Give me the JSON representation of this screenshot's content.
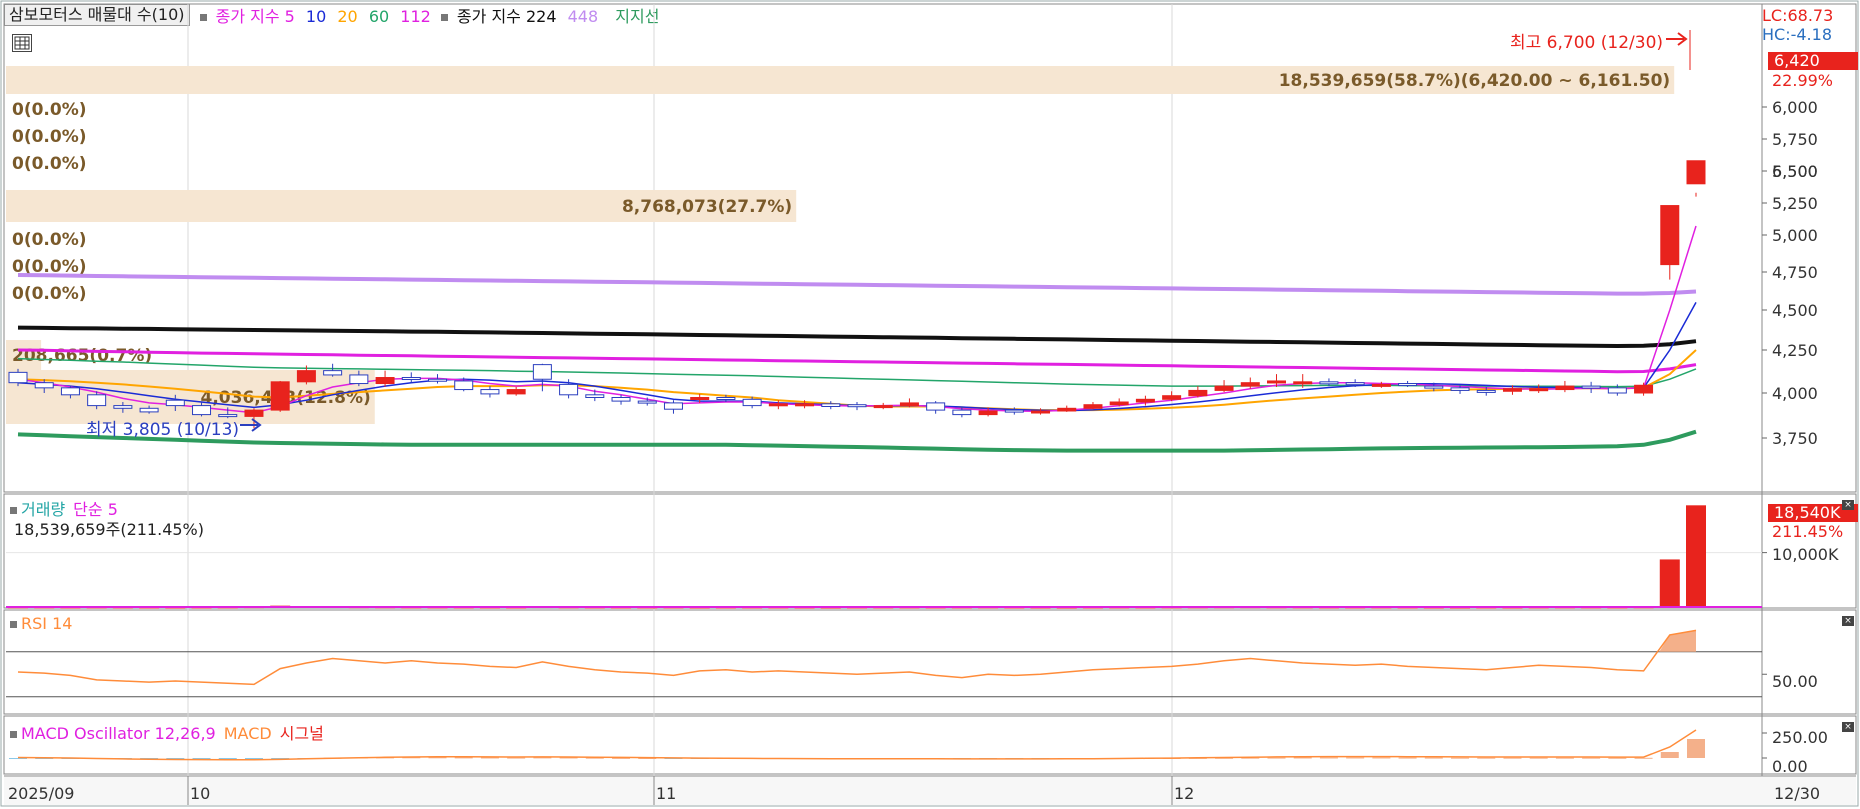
{
  "colors": {
    "up": "#e8231d",
    "down": "#2b3fbf",
    "ma5": "#e020e0",
    "ma10": "#1a2bd6",
    "ma20": "#ffa500",
    "ma60": "#23a56a",
    "ma112": "#e020e0",
    "ma224": "#111111",
    "ma448": "#c08cf0",
    "support": "#2e9b5e",
    "rsi": "#ff8c3a",
    "macd_osc": "#e020e0",
    "signal": "#e8231d",
    "volbar": "#e8231d",
    "profile": "#f6e6d2"
  },
  "header": {
    "title": "삼보모터스 매물대 수(10)",
    "ma_label": "종가 지수 5",
    "ma_periods": [
      "10",
      "20",
      "60",
      "112"
    ],
    "ma2_label": "종가 지수 224",
    "ma2_periods": [
      "448"
    ],
    "support_label": "지지선"
  },
  "price_panel": {
    "lc": "LC:68.73",
    "hc": "HC:-4.18",
    "current": "6,420",
    "change_pct": "22.99%",
    "yticks": [
      "6,500",
      "6,000",
      "5,750",
      "5,500",
      "5,250",
      "5,000",
      "4,750",
      "4,500",
      "4,250",
      "4,000",
      "3,750"
    ],
    "high_note": "최고 6,700 (12/30)",
    "low_note": "최저 3,805 (10/13)",
    "profile": [
      {
        "label": "18,539,659(58.7%)(6,420.00 ~ 6,161.50)",
        "w": 0.95,
        "hot": true
      },
      {
        "label": "0(0.0%)",
        "w": 0
      },
      {
        "label": "0(0.0%)",
        "w": 0
      },
      {
        "label": "0(0.0%)",
        "w": 0
      },
      {
        "label": "8,768,073(27.7%)",
        "w": 0.45
      },
      {
        "label": "0(0.0%)",
        "w": 0
      },
      {
        "label": "0(0.0%)",
        "w": 0
      },
      {
        "label": "0(0.0%)",
        "w": 0
      },
      {
        "label": "208,665(0.7%)",
        "w": 0.02
      },
      {
        "label": "4,036,443(12.8%)",
        "w": 0.21
      }
    ]
  },
  "volume_panel": {
    "title": "거래량",
    "ma_label": "단순 5",
    "summary": "18,539,659주(211.45%)",
    "current": "18,540K",
    "pct": "211.45%",
    "tick": "10,000K"
  },
  "rsi_panel": {
    "title": "RSI 14",
    "tick": "50.00"
  },
  "macd_panel": {
    "title": "MACD Oscillator 12,26,9",
    "l2": "MACD",
    "l3": "시그널",
    "ticks": [
      "250.00",
      "0.00"
    ]
  },
  "xaxis": {
    "labels": [
      "2025/09",
      "10",
      "11",
      "12"
    ],
    "last": "12/30"
  },
  "chart_data": {
    "type": "candlestick",
    "x_dates": [
      "2025/09/29",
      "2025/09/30",
      "2025/10/01",
      "2025/10/02",
      "2025/10/06",
      "2025/10/07",
      "2025/10/08",
      "2025/10/09",
      "2025/10/10",
      "2025/10/13",
      "2025/10/14",
      "2025/10/15",
      "2025/10/16",
      "2025/10/17",
      "2025/10/20",
      "2025/10/21",
      "2025/10/22",
      "2025/10/23",
      "2025/10/24",
      "2025/10/27",
      "2025/10/28",
      "2025/10/29",
      "2025/10/30",
      "2025/10/31",
      "2025/11/03",
      "2025/11/04",
      "2025/11/05",
      "2025/11/06",
      "2025/11/07",
      "2025/11/10",
      "2025/11/11",
      "2025/11/12",
      "2025/11/13",
      "2025/11/14",
      "2025/11/17",
      "2025/11/18",
      "2025/11/19",
      "2025/11/20",
      "2025/11/21",
      "2025/11/24",
      "2025/11/25",
      "2025/11/26",
      "2025/11/27",
      "2025/11/28",
      "2025/12/01",
      "2025/12/02",
      "2025/12/03",
      "2025/12/04",
      "2025/12/05",
      "2025/12/08",
      "2025/12/09",
      "2025/12/10",
      "2025/12/11",
      "2025/12/12",
      "2025/12/15",
      "2025/12/16",
      "2025/12/17",
      "2025/12/18",
      "2025/12/19",
      "2025/12/22",
      "2025/12/23",
      "2025/12/24",
      "2025/12/26",
      "2025/12/29",
      "2025/12/30"
    ],
    "open": [
      4120,
      4060,
      4030,
      3990,
      3930,
      3915,
      3960,
      3930,
      3880,
      3870,
      3905,
      4065,
      4130,
      4105,
      4055,
      4090,
      4080,
      4070,
      4020,
      3995,
      4165,
      4050,
      3990,
      3975,
      3955,
      3945,
      3965,
      3975,
      3965,
      3930,
      3940,
      3940,
      3935,
      3925,
      3930,
      3945,
      3905,
      3880,
      3905,
      3895,
      3900,
      3915,
      3935,
      3950,
      3965,
      3985,
      4015,
      4040,
      4060,
      4060,
      4065,
      4060,
      4050,
      4055,
      4040,
      4030,
      4015,
      4010,
      4025,
      4020,
      4040,
      4030,
      4000,
      4800,
      5400
    ],
    "close": [
      4060,
      4030,
      3990,
      3930,
      3915,
      3895,
      3930,
      3880,
      3870,
      3905,
      4065,
      4130,
      4105,
      4055,
      4090,
      4080,
      4070,
      4020,
      3995,
      4020,
      4080,
      3990,
      3975,
      3955,
      3945,
      3910,
      3975,
      3965,
      3930,
      3940,
      3940,
      3925,
      3925,
      3930,
      3945,
      3905,
      3880,
      3900,
      3895,
      3900,
      3915,
      3935,
      3950,
      3965,
      3985,
      4015,
      4040,
      4060,
      4070,
      4065,
      4060,
      4050,
      4050,
      4050,
      4030,
      4015,
      4010,
      4025,
      4025,
      4040,
      4030,
      4000,
      4045,
      5230,
      6420
    ],
    "high": [
      4140,
      4080,
      4040,
      4010,
      3950,
      3930,
      3990,
      3950,
      3920,
      3915,
      4070,
      4160,
      4170,
      4130,
      4130,
      4120,
      4110,
      4090,
      4040,
      4035,
      4170,
      4080,
      4020,
      3990,
      3975,
      3960,
      3995,
      3990,
      3980,
      3960,
      3960,
      3955,
      3950,
      3945,
      3970,
      3955,
      3925,
      3920,
      3920,
      3915,
      3930,
      3950,
      3970,
      3985,
      4010,
      4040,
      4075,
      4090,
      4110,
      4110,
      4085,
      4080,
      4065,
      4070,
      4060,
      4045,
      4035,
      4045,
      4050,
      4070,
      4065,
      4050,
      4060,
      5230,
      6700
    ],
    "low": [
      4040,
      4000,
      3970,
      3910,
      3890,
      3885,
      3900,
      3870,
      3860,
      3805,
      3895,
      4050,
      4095,
      4040,
      4035,
      4060,
      4055,
      4010,
      3975,
      3985,
      4010,
      3970,
      3955,
      3935,
      3930,
      3885,
      3945,
      3950,
      3915,
      3910,
      3915,
      3910,
      3905,
      3910,
      3920,
      3885,
      3865,
      3870,
      3880,
      3880,
      3895,
      3910,
      3925,
      3930,
      3955,
      3975,
      4005,
      4025,
      4035,
      4030,
      4040,
      4035,
      4030,
      4035,
      4010,
      3995,
      3985,
      3990,
      4000,
      4005,
      4000,
      3985,
      3985,
      4700,
      5330
    ],
    "volume_k": [
      120,
      110,
      95,
      105,
      100,
      90,
      85,
      95,
      110,
      150,
      420,
      260,
      180,
      150,
      130,
      110,
      105,
      100,
      95,
      90,
      170,
      120,
      100,
      90,
      95,
      100,
      85,
      90,
      95,
      90,
      85,
      80,
      90,
      95,
      100,
      90,
      100,
      110,
      90,
      85,
      80,
      90,
      100,
      95,
      110,
      120,
      130,
      140,
      120,
      110,
      100,
      95,
      100,
      90,
      85,
      80,
      90,
      85,
      100,
      110,
      105,
      95,
      120,
      8768,
      18540
    ],
    "ma224": [
      4390,
      4388,
      4386,
      4385,
      4383,
      4382,
      4380,
      4378,
      4377,
      4375,
      4373,
      4372,
      4370,
      4369,
      4367,
      4365,
      4364,
      4362,
      4360,
      4358,
      4356,
      4354,
      4352,
      4350,
      4348,
      4346,
      4344,
      4342,
      4340,
      4338,
      4336,
      4334,
      4332,
      4330,
      4328,
      4326,
      4324,
      4322,
      4320,
      4318,
      4316,
      4314,
      4312,
      4310,
      4308,
      4306,
      4304,
      4302,
      4300,
      4298,
      4296,
      4294,
      4292,
      4290,
      4288,
      4286,
      4284,
      4282,
      4280,
      4278,
      4276,
      4275,
      4276,
      4286,
      4305
    ],
    "ma448": [
      4730,
      4728,
      4726,
      4724,
      4722,
      4720,
      4718,
      4716,
      4714,
      4712,
      4710,
      4708,
      4706,
      4704,
      4702,
      4700,
      4698,
      4696,
      4694,
      4692,
      4690,
      4688,
      4686,
      4684,
      4682,
      4680,
      4678,
      4676,
      4674,
      4672,
      4670,
      4668,
      4666,
      4664,
      4662,
      4660,
      4658,
      4656,
      4654,
      4652,
      4650,
      4648,
      4646,
      4644,
      4642,
      4640,
      4638,
      4636,
      4634,
      4632,
      4630,
      4628,
      4626,
      4624,
      4622,
      4620,
      4618,
      4616,
      4614,
      4612,
      4610,
      4608,
      4608,
      4612,
      4622
    ],
    "ma112": [
      4250,
      4248,
      4245,
      4242,
      4240,
      4237,
      4235,
      4232,
      4230,
      4228,
      4226,
      4224,
      4222,
      4220,
      4218,
      4216,
      4214,
      4212,
      4210,
      4208,
      4206,
      4204,
      4202,
      4200,
      4198,
      4196,
      4194,
      4192,
      4190,
      4188,
      4186,
      4184,
      4182,
      4180,
      4178,
      4176,
      4174,
      4172,
      4170,
      4168,
      4166,
      4164,
      4162,
      4160,
      4158,
      4156,
      4154,
      4152,
      4150,
      4148,
      4146,
      4144,
      4142,
      4140,
      4138,
      4136,
      4134,
      4132,
      4130,
      4128,
      4126,
      4124,
      4125,
      4140,
      4165
    ],
    "ma60": [
      4200,
      4195,
      4190,
      4185,
      4180,
      4174,
      4168,
      4162,
      4156,
      4150,
      4146,
      4144,
      4142,
      4140,
      4138,
      4136,
      4134,
      4132,
      4130,
      4127,
      4125,
      4122,
      4119,
      4116,
      4113,
      4109,
      4106,
      4103,
      4100,
      4096,
      4092,
      4088,
      4084,
      4080,
      4076,
      4072,
      4068,
      4064,
      4060,
      4056,
      4052,
      4049,
      4046,
      4043,
      4040,
      4040,
      4040,
      4041,
      4042,
      4043,
      4044,
      4044,
      4044,
      4043,
      4042,
      4041,
      4040,
      4040,
      4039,
      4039,
      4038,
      4037,
      4039,
      4080,
      4140
    ],
    "ma20": [
      4080,
      4075,
      4068,
      4060,
      4050,
      4038,
      4025,
      4010,
      3995,
      3980,
      3975,
      3985,
      3995,
      4005,
      4015,
      4025,
      4035,
      4040,
      4040,
      4040,
      4045,
      4045,
      4040,
      4030,
      4020,
      4005,
      3995,
      3985,
      3975,
      3960,
      3950,
      3940,
      3930,
      3925,
      3925,
      3925,
      3920,
      3915,
      3910,
      3905,
      3905,
      3905,
      3908,
      3912,
      3918,
      3925,
      3935,
      3948,
      3960,
      3970,
      3980,
      3990,
      4000,
      4008,
      4015,
      4020,
      4022,
      4024,
      4026,
      4028,
      4028,
      4026,
      4030,
      4110,
      4250
    ],
    "ma10": [
      4060,
      4050,
      4040,
      4025,
      4005,
      3985,
      3965,
      3950,
      3935,
      3920,
      3935,
      3960,
      3990,
      4015,
      4040,
      4060,
      4075,
      4080,
      4075,
      4065,
      4070,
      4060,
      4040,
      4015,
      3990,
      3965,
      3955,
      3955,
      3955,
      3945,
      3940,
      3935,
      3930,
      3928,
      3930,
      3928,
      3922,
      3914,
      3908,
      3904,
      3902,
      3906,
      3914,
      3924,
      3936,
      3950,
      3966,
      3984,
      4002,
      4018,
      4032,
      4042,
      4050,
      4054,
      4054,
      4050,
      4044,
      4038,
      4034,
      4032,
      4030,
      4026,
      4030,
      4250,
      4550
    ],
    "ma5": [
      4080,
      4060,
      4035,
      4005,
      3970,
      3945,
      3935,
      3920,
      3905,
      3890,
      3925,
      3985,
      4035,
      4060,
      4080,
      4085,
      4085,
      4075,
      4055,
      4040,
      4050,
      4040,
      4010,
      3990,
      3965,
      3940,
      3945,
      3950,
      3950,
      3940,
      3935,
      3930,
      3928,
      3930,
      3932,
      3925,
      3912,
      3905,
      3900,
      3898,
      3905,
      3915,
      3930,
      3945,
      3960,
      3980,
      4000,
      4025,
      4045,
      4055,
      4060,
      4060,
      4055,
      4052,
      4045,
      4038,
      4030,
      4025,
      4022,
      4025,
      4028,
      4025,
      4030,
      4500,
      5070
    ],
    "support": [
      3770,
      3765,
      3760,
      3755,
      3750,
      3745,
      3740,
      3735,
      3730,
      3725,
      3722,
      3720,
      3718,
      3716,
      3714,
      3712,
      3712,
      3712,
      3712,
      3712,
      3712,
      3712,
      3712,
      3712,
      3712,
      3712,
      3712,
      3712,
      3710,
      3708,
      3705,
      3702,
      3700,
      3697,
      3694,
      3691,
      3688,
      3685,
      3683,
      3681,
      3680,
      3680,
      3680,
      3680,
      3680,
      3680,
      3680,
      3682,
      3684,
      3686,
      3688,
      3690,
      3692,
      3694,
      3695,
      3696,
      3697,
      3698,
      3699,
      3700,
      3702,
      3704,
      3712,
      3740,
      3785
    ],
    "rsi": [
      52,
      51,
      49,
      45,
      44,
      43,
      44,
      43,
      42,
      41,
      55,
      60,
      64,
      62,
      60,
      62,
      60,
      59,
      57,
      56,
      61,
      57,
      54,
      52,
      51,
      49,
      53,
      54,
      52,
      53,
      52,
      51,
      50,
      51,
      52,
      49,
      47,
      50,
      49,
      50,
      52,
      54,
      55,
      56,
      57,
      59,
      62,
      64,
      62,
      60,
      59,
      58,
      59,
      57,
      56,
      55,
      54,
      56,
      58,
      57,
      56,
      54,
      53,
      85,
      89
    ],
    "macd_osc": [
      -5,
      -6,
      -8,
      -10,
      -12,
      -13,
      -14,
      -14,
      -15,
      -14,
      -8,
      -2,
      3,
      5,
      6,
      7,
      7,
      6,
      5,
      4,
      6,
      5,
      3,
      1,
      0,
      -2,
      -3,
      -3,
      -4,
      -4,
      -4,
      -5,
      -5,
      -5,
      -4,
      -4,
      -5,
      -5,
      -5,
      -5,
      -4,
      -3,
      -2,
      -1,
      0,
      1,
      2,
      3,
      4,
      5,
      5,
      5,
      5,
      4,
      4,
      3,
      3,
      3,
      3,
      3,
      3,
      2,
      2,
      60,
      190
    ],
    "macd": [
      5,
      3,
      0,
      -5,
      -9,
      -13,
      -15,
      -16,
      -17,
      -18,
      -14,
      -8,
      -2,
      3,
      7,
      10,
      12,
      12,
      11,
      10,
      11,
      10,
      8,
      6,
      4,
      1,
      -1,
      -2,
      -4,
      -5,
      -6,
      -7,
      -8,
      -8,
      -8,
      -8,
      -9,
      -9,
      -9,
      -9,
      -8,
      -7,
      -5,
      -3,
      -1,
      2,
      5,
      8,
      11,
      13,
      14,
      14,
      14,
      13,
      12,
      11,
      10,
      10,
      10,
      10,
      10,
      9,
      9,
      110,
      280
    ],
    "ylim": [
      3500,
      6800
    ]
  }
}
